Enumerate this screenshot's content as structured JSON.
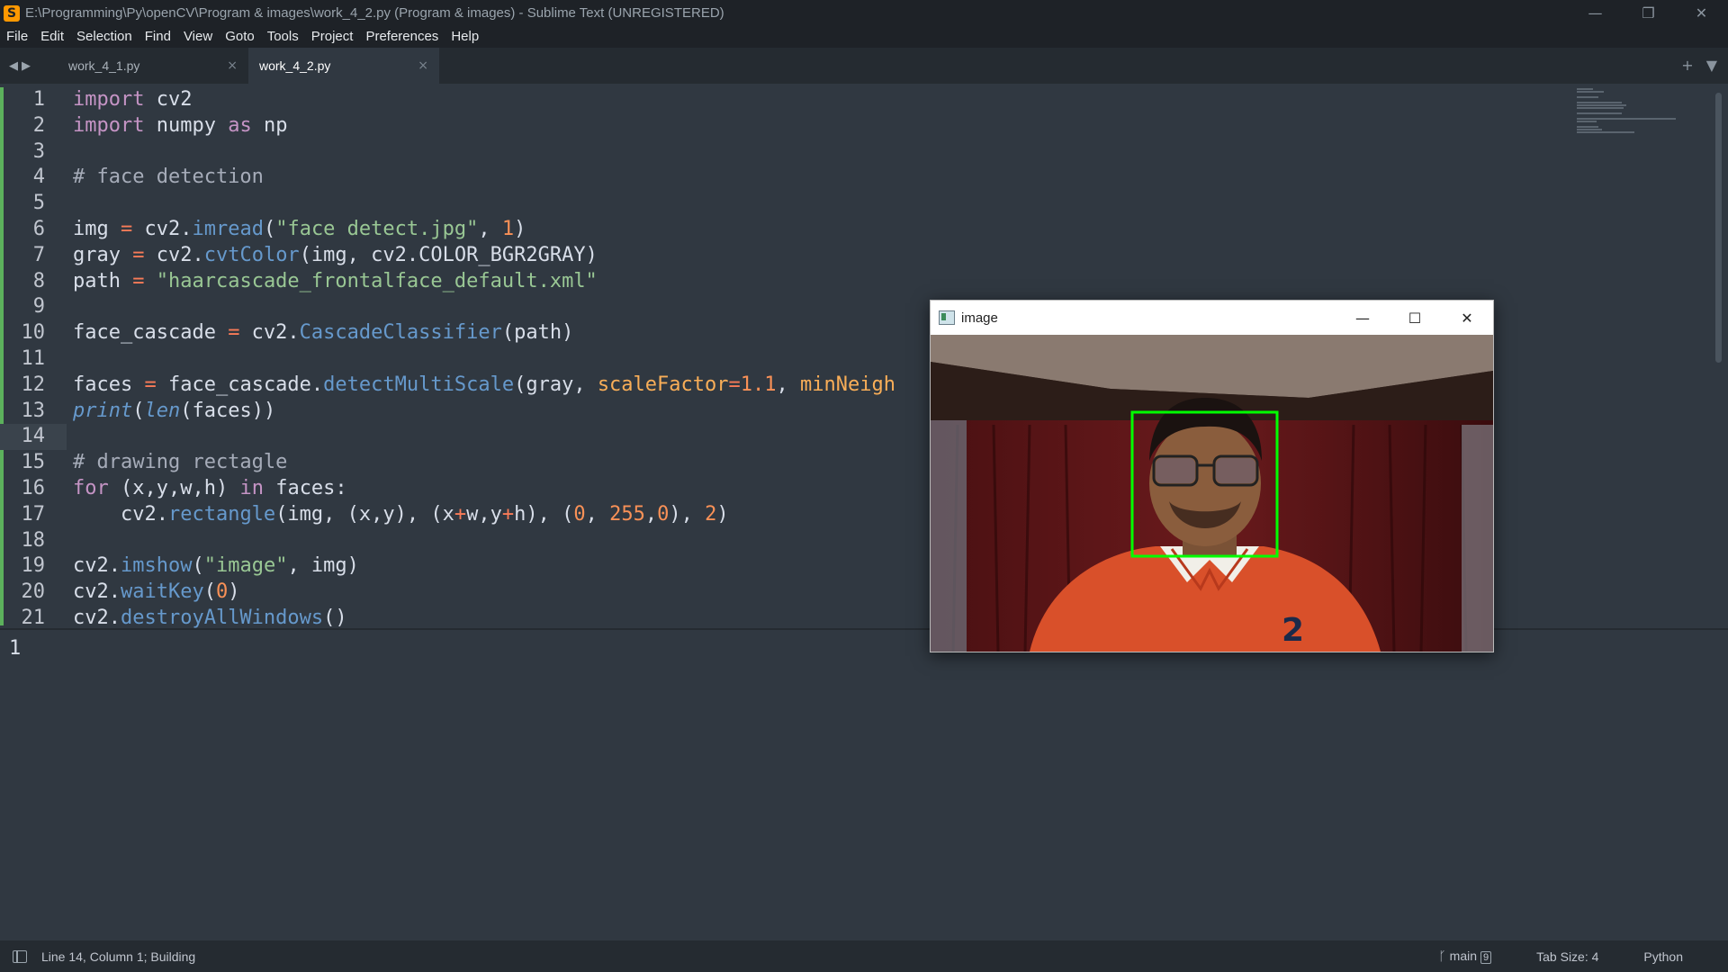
{
  "window": {
    "title": "E:\\Programming\\Py\\openCV\\Program & images\\work_4_2.py (Program & images) - Sublime Text (UNREGISTERED)",
    "app_icon_letter": "S",
    "controls": {
      "minimize": "—",
      "restore": "❐",
      "close": "✕"
    }
  },
  "menu": {
    "items": [
      "File",
      "Edit",
      "Selection",
      "Find",
      "View",
      "Goto",
      "Tools",
      "Project",
      "Preferences",
      "Help"
    ]
  },
  "tabs": {
    "nav_prev": "◀",
    "nav_next": "▶",
    "items": [
      {
        "label": "work_4_1.py",
        "close": "×"
      },
      {
        "label": "work_4_2.py",
        "close": "×"
      }
    ],
    "new_tab": "+",
    "menu": "▼"
  },
  "editor": {
    "current_line": 14,
    "line_numbers": [
      "1",
      "2",
      "3",
      "4",
      "5",
      "6",
      "7",
      "8",
      "9",
      "10",
      "11",
      "12",
      "13",
      "14",
      "15",
      "16",
      "17",
      "18",
      "19",
      "20",
      "21"
    ],
    "code_lines": [
      "import cv2",
      "import numpy as np",
      "",
      "# face detection",
      "",
      "img = cv2.imread(\"face detect.jpg\", 1)",
      "gray = cv2.cvtColor(img, cv2.COLOR_BGR2GRAY)",
      "path = \"haarcascade_frontalface_default.xml\"",
      "",
      "face_cascade = cv2.CascadeClassifier(path)",
      "",
      "faces = face_cascade.detectMultiScale(gray, scaleFactor=1.1, minNeigh",
      "print(len(faces))",
      "",
      "# drawing rectagle",
      "for (x,y,w,h) in faces:",
      "    cv2.rectangle(img, (x,y), (x+w,y+h), (0, 255,0), 2)",
      "",
      "cv2.imshow(\"image\", img)",
      "cv2.waitKey(0)",
      "cv2.destroyAllWindows()"
    ]
  },
  "output": {
    "text": "1"
  },
  "image_window": {
    "title": "image",
    "controls": {
      "minimize": "—",
      "maximize": "☐",
      "close": "✕"
    },
    "detection_box_color": "#00ff00"
  },
  "status": {
    "position": "Line 14, Column 1; Building",
    "branch": "main",
    "branch_icon": "ᚴ",
    "branch_badge": "9",
    "tab_size": "Tab Size: 4",
    "syntax": "Python"
  },
  "colors": {
    "background": "#303841",
    "keyword": "#c594c5",
    "function": "#6699cc",
    "string": "#99c794",
    "number": "#f99157",
    "comment": "#a6acb9",
    "modified_marker": "#5cb15c"
  }
}
